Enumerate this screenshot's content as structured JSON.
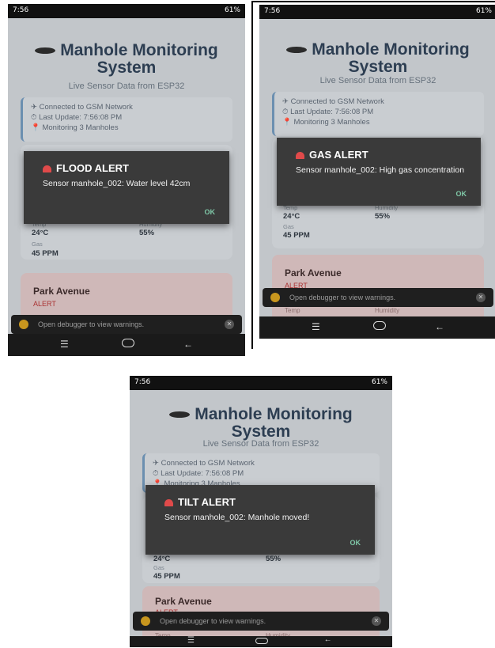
{
  "status": {
    "time": "7:56",
    "battery": "61%"
  },
  "app": {
    "title_line1": "Manhole Monitoring",
    "title_line2": "System",
    "subtitle": "Live Sensor Data from ESP32",
    "connection": "Connected to GSM Network",
    "last_update": "Last Update: 7:56:08 PM",
    "monitoring": "Monitoring 3 Manholes",
    "temp_label": "Temp",
    "temp_value": "24°C",
    "humidity_label": "Humidity",
    "humidity_value": "55%",
    "gas_label": "Gas",
    "gas_value": "45 PPM",
    "park_title": "Park Avenue",
    "park_alert": "ALERT",
    "park_temp": "Temp",
    "park_humidity": "Humidity"
  },
  "toast": {
    "text": "Open debugger to view warnings."
  },
  "dialogs": [
    {
      "title": "FLOOD ALERT",
      "message": "Sensor manhole_002: Water level 42cm",
      "ok": "OK"
    },
    {
      "title": "GAS ALERT",
      "message": "Sensor manhole_002: High gas concentration",
      "ok": "OK"
    },
    {
      "title": "TILT ALERT",
      "message": "Sensor manhole_002: Manhole moved!",
      "ok": "OK"
    }
  ],
  "colors": {
    "accent": "#2d3e52",
    "alert": "#e04a4a",
    "ok": "#7fc7a7"
  }
}
